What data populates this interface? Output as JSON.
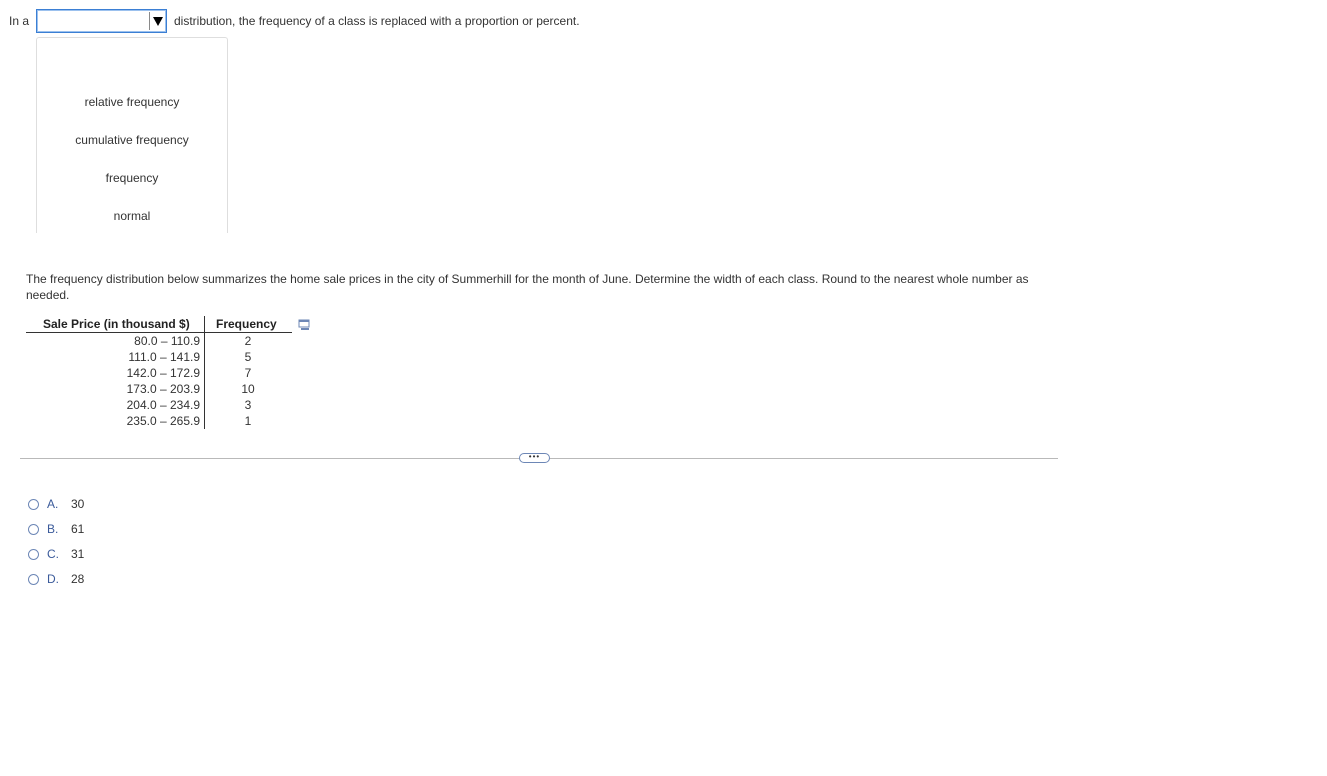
{
  "question1": {
    "prefix": "In a",
    "dropdown_value": "",
    "suffix": "distribution, the frequency of a class is replaced with a proportion or percent.",
    "options": [
      "relative frequency",
      "cumulative frequency",
      "frequency",
      "normal"
    ]
  },
  "question2": {
    "text": "The frequency distribution below summarizes the home sale prices in the city of Summerhill for the month of June. Determine the width of each class. Round to the nearest whole number as needed.",
    "table": {
      "headers": [
        "Sale Price (in thousand $)",
        "Frequency"
      ],
      "rows": [
        {
          "class": "80.0 – 110.9",
          "frequency": "2"
        },
        {
          "class": "111.0 – 141.9",
          "frequency": "5"
        },
        {
          "class": "142.0 – 172.9",
          "frequency": "7"
        },
        {
          "class": "173.0 – 203.9",
          "frequency": "10"
        },
        {
          "class": "204.0 – 234.9",
          "frequency": "3"
        },
        {
          "class": "235.0 – 265.9",
          "frequency": "1"
        }
      ]
    },
    "more_label": "•••",
    "choices": [
      {
        "letter": "A.",
        "value": "30"
      },
      {
        "letter": "B.",
        "value": "61"
      },
      {
        "letter": "C.",
        "value": "31"
      },
      {
        "letter": "D.",
        "value": "28"
      }
    ]
  },
  "colors": {
    "accent": "#3b7fd4",
    "radio_border": "#6d87b6",
    "text": "#333333"
  },
  "icons": [
    "dropdown-arrow-icon",
    "copy-icon",
    "radio-icon"
  ]
}
